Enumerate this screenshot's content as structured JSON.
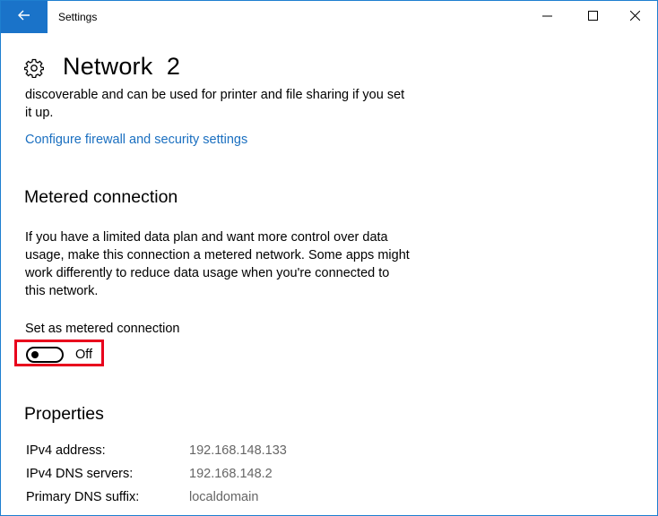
{
  "titlebar": {
    "title": "Settings",
    "icons": [
      "back-arrow-icon",
      "minimize-icon",
      "maximize-icon",
      "close-icon"
    ]
  },
  "header": {
    "icon": "gear-icon",
    "title": "Network  2"
  },
  "intro": {
    "line1": "discoverable and can be used for printer and file sharing if you set",
    "line2": "it up."
  },
  "firewall_link": "Configure firewall and security settings",
  "metered": {
    "heading": "Metered connection",
    "description_lines": [
      "If you have a limited data plan and want more control over data",
      "usage, make this connection a metered network. Some apps might",
      "work differently to reduce data usage when you're connected to",
      "this network."
    ],
    "toggle_label": "Set as metered connection",
    "toggle_state": "Off",
    "toggle_on": false
  },
  "properties": {
    "heading": "Properties",
    "rows": [
      {
        "key": "IPv4 address:",
        "value": "192.168.148.133"
      },
      {
        "key": "IPv4 DNS servers:",
        "value": "192.168.148.2"
      },
      {
        "key": "Primary DNS suffix:",
        "value": "localdomain"
      }
    ]
  },
  "colors": {
    "accent": "#1a73c9",
    "link": "#1a6fc0",
    "highlight": "#e8001c",
    "secondary_text": "#666666"
  }
}
